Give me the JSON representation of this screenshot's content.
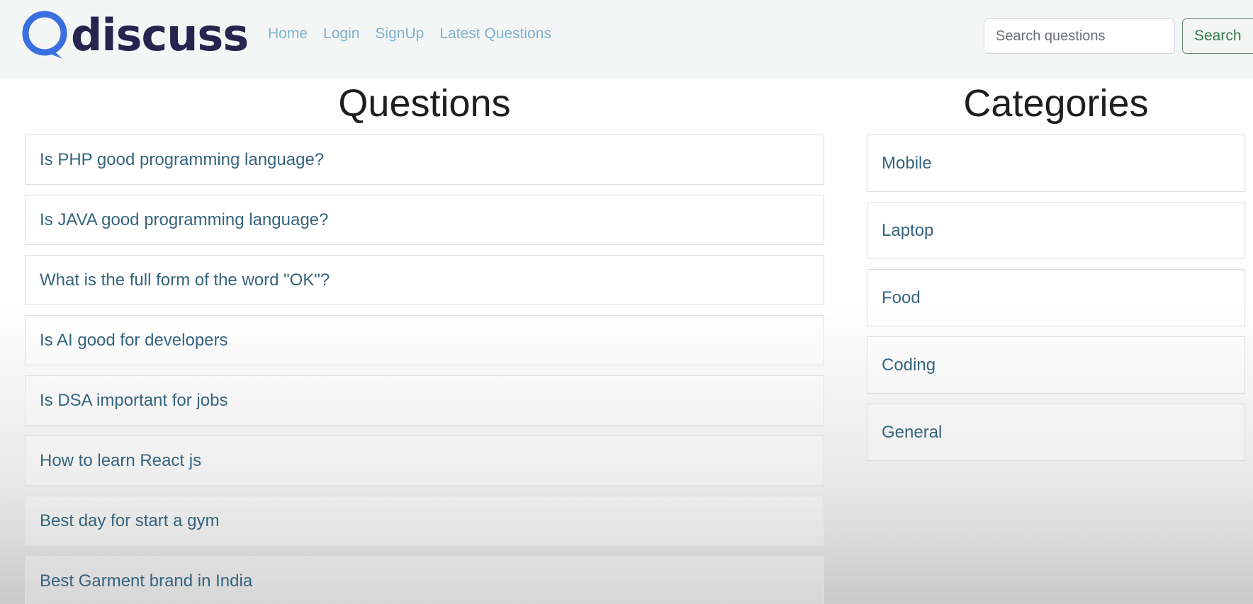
{
  "navbar": {
    "logo_text": "discuss",
    "links": [
      {
        "label": "Home"
      },
      {
        "label": "Login"
      },
      {
        "label": "SignUp"
      },
      {
        "label": "Latest Questions"
      }
    ],
    "search": {
      "placeholder": "Search questions",
      "value": "",
      "button_label": "Search"
    }
  },
  "colors": {
    "logo_blue": "#3a6fe0",
    "logo_text": "#26254f",
    "nav_link": "#7fb2c9",
    "item_text": "#35647d",
    "search_button": "#2f7a46"
  },
  "questions": {
    "title": "Questions",
    "items": [
      {
        "text": "Is PHP good programming language?"
      },
      {
        "text": "Is JAVA good programming language?"
      },
      {
        "text": "What is the full form of the word \"OK\"?"
      },
      {
        "text": "Is AI good for developers"
      },
      {
        "text": "Is DSA important for jobs"
      },
      {
        "text": "How to learn React js"
      },
      {
        "text": "Best day for start a gym"
      },
      {
        "text": "Best Garment brand in India"
      }
    ]
  },
  "categories": {
    "title": "Categories",
    "items": [
      {
        "text": "Mobile"
      },
      {
        "text": "Laptop"
      },
      {
        "text": "Food"
      },
      {
        "text": "Coding"
      },
      {
        "text": "General"
      }
    ]
  }
}
